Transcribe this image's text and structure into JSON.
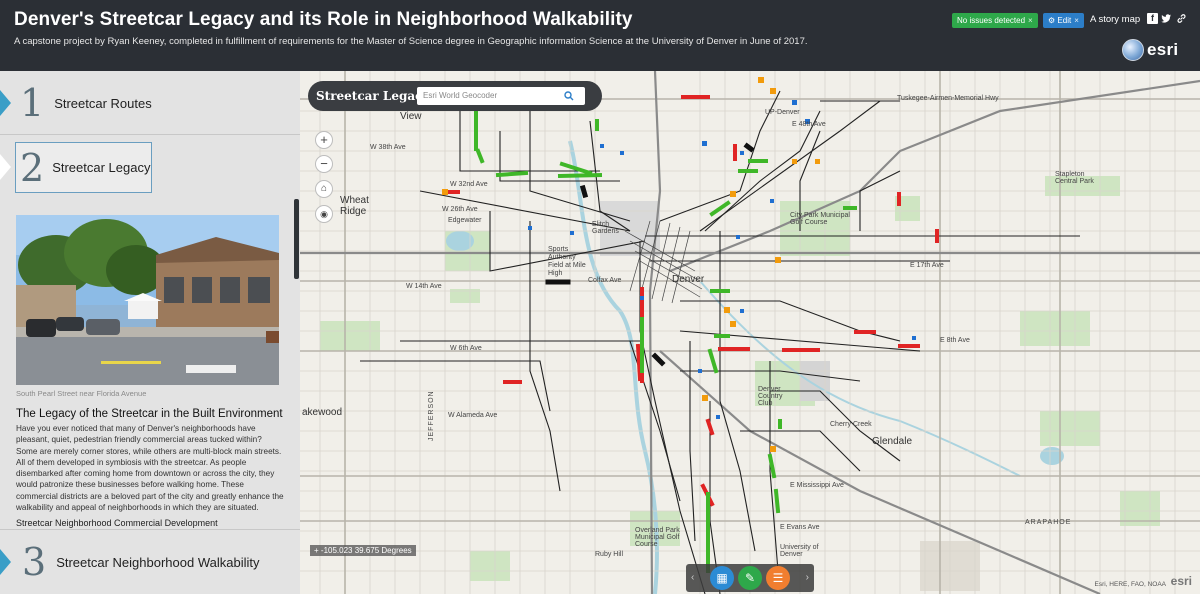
{
  "header": {
    "title": "Denver's Streetcar Legacy and its Role in Neighborhood Walkability",
    "subtitle": "A capstone project by Ryan Keeney, completed in fulfillment of requirements for the Master of Science degree in Geographic information Science at the University of Denver in June of 2017.",
    "badge_status": "No issues detected",
    "badge_edit": "Edit",
    "story_map": "A story map",
    "brand": "esri"
  },
  "sidebar": {
    "entries": [
      {
        "num": "1",
        "label": "Streetcar Routes"
      },
      {
        "num": "2",
        "label": "Streetcar Legacy"
      },
      {
        "num": "3",
        "label": "Streetcar Neighborhood Walkability"
      }
    ],
    "photo_caption": "South Pearl Street near Florida Avenue",
    "section_title": "The Legacy of the Streetcar in the Built Environment",
    "body": "Have you ever noticed that many of Denver's neighborhoods have pleasant, quiet, pedestrian friendly commercial areas tucked within? Some are merely corner stores, while others are multi-block main streets. All of them developed in symbiosis with the streetcar. As people disembarked after coming home from downtown or across the city, they would patronize these businesses before walking home. These commercial districts are a beloved part of the city and greatly enhance the walkability and appeal of neighborhoods in which they are situated.",
    "sub_heading": "Streetcar Neighborhood Commercial Development"
  },
  "map": {
    "search_title": "Streetcar Legacy",
    "search_placeholder": "Esri World Geocoder",
    "coordinates": "-105.023 39.675 Degrees",
    "attribution": "Esri, HERE, FAO, NOAA",
    "logo": "esri",
    "labels": {
      "denver": "Denver",
      "wheat_ridge": "Wheat Ridge",
      "glendale": "Glendale",
      "lakewood": "akewood",
      "view": "View",
      "edgewater": "Edgewater",
      "city_park": "City Park Municipal Golf Course",
      "denver_cc": "Denver Country Club",
      "stapleton": "Stapleton Central Park",
      "w38": "W 38th Ave",
      "w32": "W 32nd Ave",
      "w26": "W 26th Ave",
      "colfax": "Colfax Ave",
      "w6": "W 6th Ave",
      "w14": "W 14th Ave",
      "alameda": "W Alameda Ave",
      "mississippi": "E Mississippi Ave",
      "evans": "E Evans Ave",
      "e17": "E 17th Ave",
      "e8": "E 8th Ave",
      "tuskegee": "Tuskegee-Airmen-Memorial Hwy",
      "e48": "E 48th Ave",
      "sports": "Sports Authority Field at Mile High",
      "elitch": "Elitch Gardens",
      "cherry_creek": "Cherry Creek",
      "arapahoe": "ARAPAHOE",
      "jefferson": "JEFFERSON",
      "up_denver": "UP-Denver",
      "univ": "University of Denver",
      "overland": "Overland Park Municipal Golf Course",
      "ruby": "Ruby Hill"
    }
  },
  "colors": {
    "header_bg": "#2b2f35",
    "accent_blue": "#2c7ec8",
    "accent_green": "#2ea84a",
    "highlight_red": "#e02424",
    "highlight_green": "#3fb728",
    "highlight_orange": "#f29b0c",
    "highlight_black": "#111111"
  }
}
